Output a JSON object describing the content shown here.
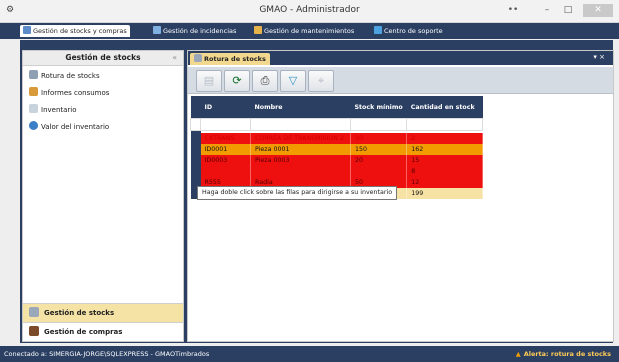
{
  "window": {
    "title": "GMAO - Administrador",
    "controls": {
      "extra": "••",
      "minimize": "–",
      "maximize": "□",
      "close": "✕"
    }
  },
  "top_tabs": [
    {
      "label": "Gestión de stocks y compras",
      "icon": "stock-icon",
      "active": true
    },
    {
      "label": "Gestión de incidencias",
      "icon": "incidents-icon"
    },
    {
      "label": "Gestión de mantenimientos",
      "icon": "maintenance-icon"
    },
    {
      "label": "Centro de soporte",
      "icon": "support-icon"
    }
  ],
  "sidebar": {
    "title": "Gestión de stocks",
    "pin": "«",
    "items": [
      {
        "label": "Rotura de stocks",
        "icon": "gears-icon"
      },
      {
        "label": "Informes consumos",
        "icon": "chart-icon"
      },
      {
        "label": "Inventario",
        "icon": "document-icon"
      },
      {
        "label": "Valor del inventario",
        "icon": "money-icon"
      }
    ],
    "sections": [
      {
        "label": "Gestión de stocks",
        "icon": "stock-icon",
        "active": true
      },
      {
        "label": "Gestión de compras",
        "icon": "purchases-icon"
      }
    ]
  },
  "content": {
    "tab": {
      "label": "Rotura de stocks",
      "icon": "gears-icon"
    },
    "tab_controls": "▾ ×",
    "toolbar": [
      {
        "icon": "new-icon",
        "glyph": "▤"
      },
      {
        "icon": "refresh-icon",
        "glyph": "⟳"
      },
      {
        "icon": "print-icon",
        "glyph": "⎙"
      },
      {
        "icon": "filter-icon",
        "glyph": "▽"
      },
      {
        "icon": "delete-icon",
        "glyph": "⌖"
      }
    ],
    "grid": {
      "columns": [
        "ID",
        "Nombre",
        "Stock mínimo",
        "Cantidad en stock"
      ],
      "rows": [
        {
          "style": "red",
          "cells": [
            "CXTRANS",
            "CORREA DE TRANSMISION 2",
            "10",
            "2"
          ]
        },
        {
          "style": "orange",
          "cells": [
            "ID0001",
            "Pieza 0001",
            "150",
            "162"
          ]
        },
        {
          "style": "red",
          "cells": [
            "ID0003",
            "Pieza 0003",
            "20",
            "15"
          ]
        },
        {
          "style": "red",
          "cells": [
            "",
            "",
            "",
            "8"
          ]
        },
        {
          "style": "red",
          "cells": [
            "R555",
            "Radia",
            "50",
            "12"
          ]
        },
        {
          "style": "total",
          "cells": [
            "",
            "",
            "",
            "199"
          ]
        }
      ]
    },
    "tooltip": "Haga doble click sobre las filas para dirigirse a su inventario"
  },
  "status": {
    "connection": "Conectado a: SIMERGIA-JORGE\\SQLEXPRESS - GMAOTimbrados",
    "alert": "Alerta: rotura de stocks"
  },
  "colors": {
    "navy": "#2b3f63",
    "row_red": "#ee0f0f",
    "row_orange": "#f29b00",
    "row_total": "#f7e2a6",
    "active_section": "#f5e3a6"
  }
}
